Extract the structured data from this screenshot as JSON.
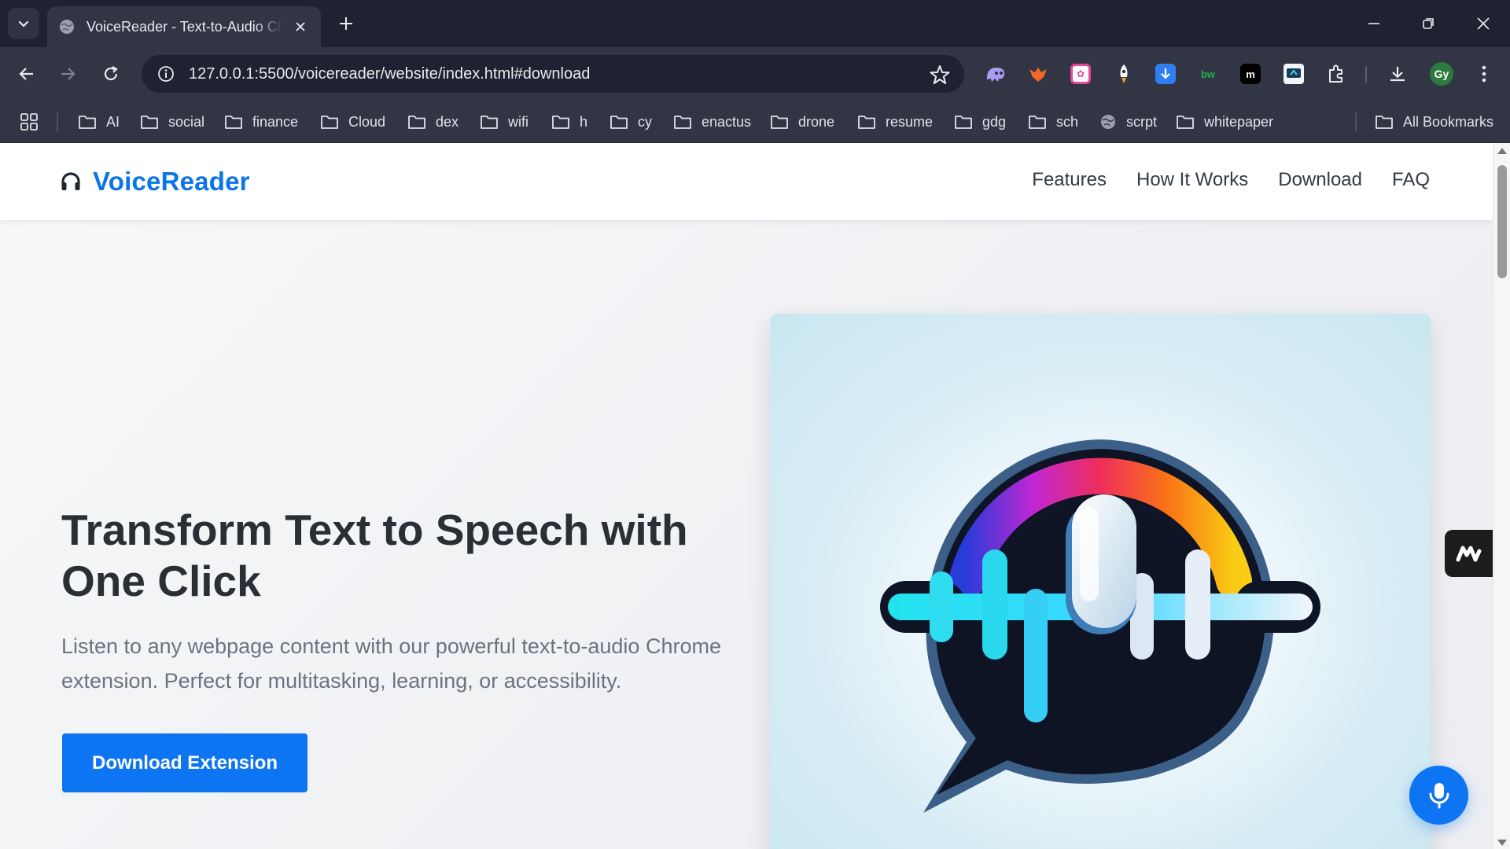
{
  "browser": {
    "tab": {
      "title": "VoiceReader - Text-to-Audio Chrome Extension"
    },
    "address_bar": {
      "url": "127.0.0.1:5500/voicereader/website/index.html#download"
    },
    "profile_initials": "Gy",
    "bookmarks": [
      {
        "label": "AI",
        "icon": "folder-icon"
      },
      {
        "label": "social",
        "icon": "folder-icon"
      },
      {
        "label": "finance",
        "icon": "folder-icon"
      },
      {
        "label": "Cloud",
        "icon": "folder-icon"
      },
      {
        "label": "dex",
        "icon": "folder-icon"
      },
      {
        "label": "wifi",
        "icon": "folder-icon"
      },
      {
        "label": "h",
        "icon": "folder-icon"
      },
      {
        "label": "cy",
        "icon": "folder-icon"
      },
      {
        "label": "enactus",
        "icon": "folder-icon"
      },
      {
        "label": "drone",
        "icon": "folder-icon"
      },
      {
        "label": "resume",
        "icon": "folder-icon"
      },
      {
        "label": "gdg",
        "icon": "folder-icon"
      },
      {
        "label": "sch",
        "icon": "folder-icon"
      },
      {
        "label": "scrpt",
        "icon": "globe-icon"
      },
      {
        "label": "whitepaper",
        "icon": "folder-icon"
      }
    ],
    "all_bookmarks_label": "All Bookmarks"
  },
  "site": {
    "logo_text": "VoiceReader",
    "nav": [
      "Features",
      "How It Works",
      "Download",
      "FAQ"
    ],
    "hero": {
      "title": "Transform Text to Speech with One Click",
      "subtitle": "Listen to any webpage content with our powerful text-to-audio Chrome extension. Perfect for multitasking, learning, or accessibility.",
      "cta_label": "Download Extension"
    }
  },
  "colors": {
    "brand_blue": "#0d74f2",
    "heading": "#2a2f36",
    "body_text": "#6b7380"
  }
}
